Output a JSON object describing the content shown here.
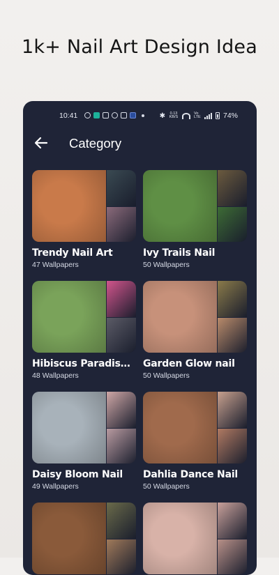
{
  "promo_title": "1k+ Nail Art Design Idea",
  "status": {
    "time": "10:41",
    "network_speed": "0.13 KB/S",
    "volte": "Vo LTE",
    "battery": "74%"
  },
  "header": {
    "title": "Category",
    "back_icon": "arrow-left-icon"
  },
  "categories": [
    {
      "name": "Trendy Nail Art",
      "count": "47 Wallpapers",
      "colors": [
        "#c97a4a",
        "#3a4a52",
        "#8a6a7a"
      ]
    },
    {
      "name": "Ivy Trails  Nail",
      "count": "50 Wallpapers",
      "colors": [
        "#5f8f45",
        "#6b5a3e",
        "#3d6b35"
      ]
    },
    {
      "name": "Hibiscus Paradise…",
      "count": "48 Wallpapers",
      "colors": [
        "#7aa35a",
        "#d2558c",
        "#5b5b66"
      ]
    },
    {
      "name": "Garden Glow nail",
      "count": "50 Wallpapers",
      "colors": [
        "#c7917a",
        "#8a7a4a",
        "#b88a6a"
      ]
    },
    {
      "name": "Daisy Bloom Nail",
      "count": "49 Wallpapers",
      "colors": [
        "#a8b2ba",
        "#cfa7a6",
        "#b89aa0"
      ]
    },
    {
      "name": "Dahlia Dance Nail",
      "count": "50 Wallpapers",
      "colors": [
        "#a06a4c",
        "#c7a08e",
        "#b07a62"
      ]
    },
    {
      "name": "",
      "count": "",
      "colors": [
        "#8a5a3a",
        "#6a6a4a",
        "#a07a5a"
      ]
    },
    {
      "name": "",
      "count": "",
      "colors": [
        "#d8b2a8",
        "#c8a09a",
        "#b89088"
      ]
    }
  ]
}
